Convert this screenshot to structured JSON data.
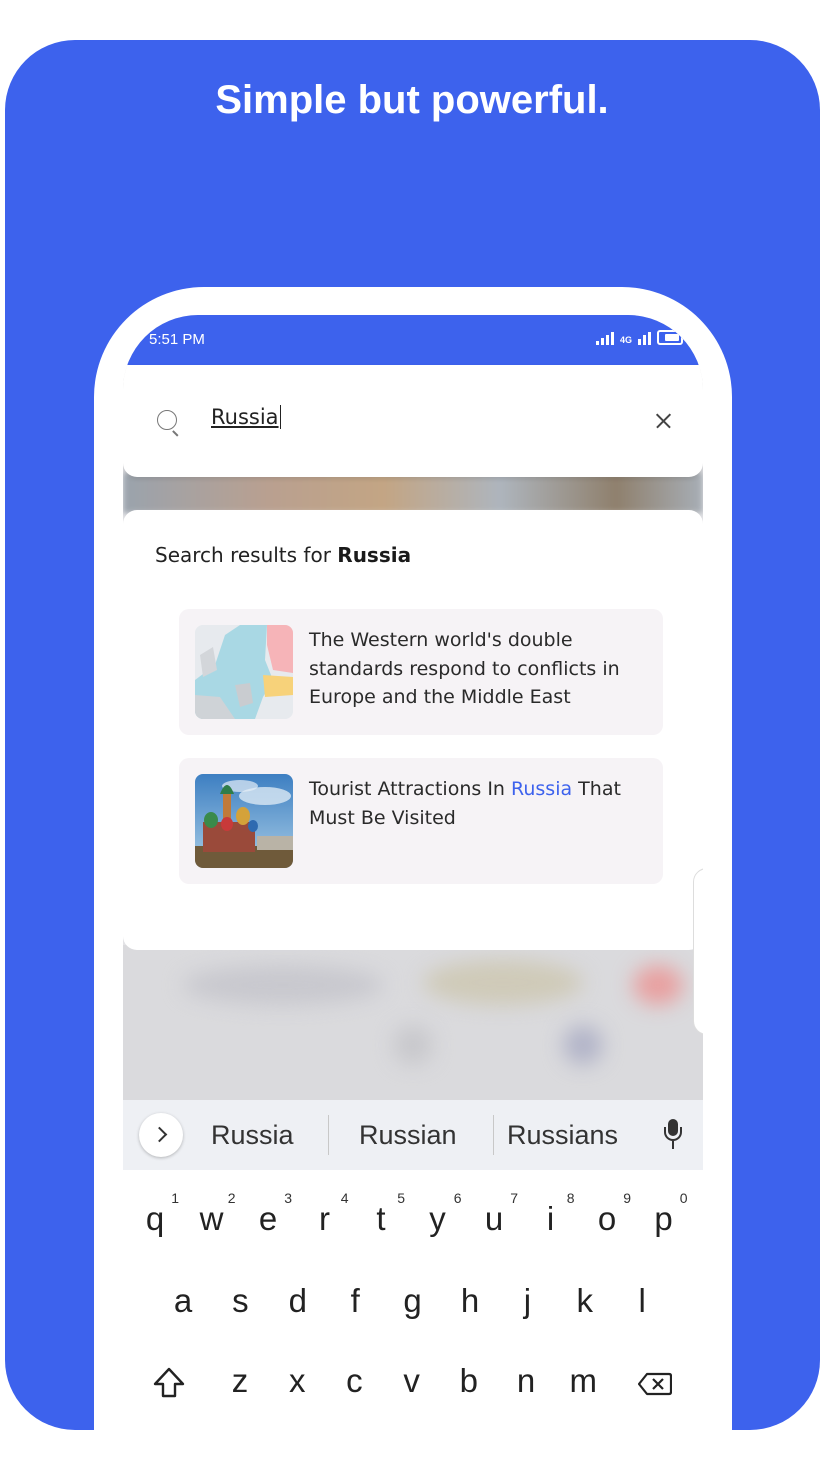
{
  "promo": {
    "headline": "Simple but powerful."
  },
  "status_bar": {
    "time": "5:51 PM",
    "network": "4G"
  },
  "search": {
    "query": "Russia"
  },
  "results": {
    "heading_prefix": "Search results for ",
    "heading_query": "Russia",
    "items": [
      {
        "title": "The Western world's double standards respond to conflicts in Europe and the Middle East",
        "thumb": "europe-map"
      },
      {
        "title_before": "Tourist Attractions In ",
        "title_highlight": "Russia",
        "title_after": " That Must Be Visited",
        "thumb": "st-basils-cathedral"
      }
    ]
  },
  "keyboard": {
    "suggestions": [
      "Russia",
      "Russian",
      "Russians"
    ],
    "row1": [
      [
        "q",
        "1"
      ],
      [
        "w",
        "2"
      ],
      [
        "e",
        "3"
      ],
      [
        "r",
        "4"
      ],
      [
        "t",
        "5"
      ],
      [
        "y",
        "6"
      ],
      [
        "u",
        "7"
      ],
      [
        "i",
        "8"
      ],
      [
        "o",
        "9"
      ],
      [
        "p",
        "0"
      ]
    ],
    "row2": [
      "a",
      "s",
      "d",
      "f",
      "g",
      "h",
      "j",
      "k",
      "l"
    ],
    "row3": [
      "z",
      "x",
      "c",
      "v",
      "b",
      "n",
      "m"
    ]
  },
  "colors": {
    "accent": "#3d62ed",
    "highlight": "#3d62ed"
  }
}
